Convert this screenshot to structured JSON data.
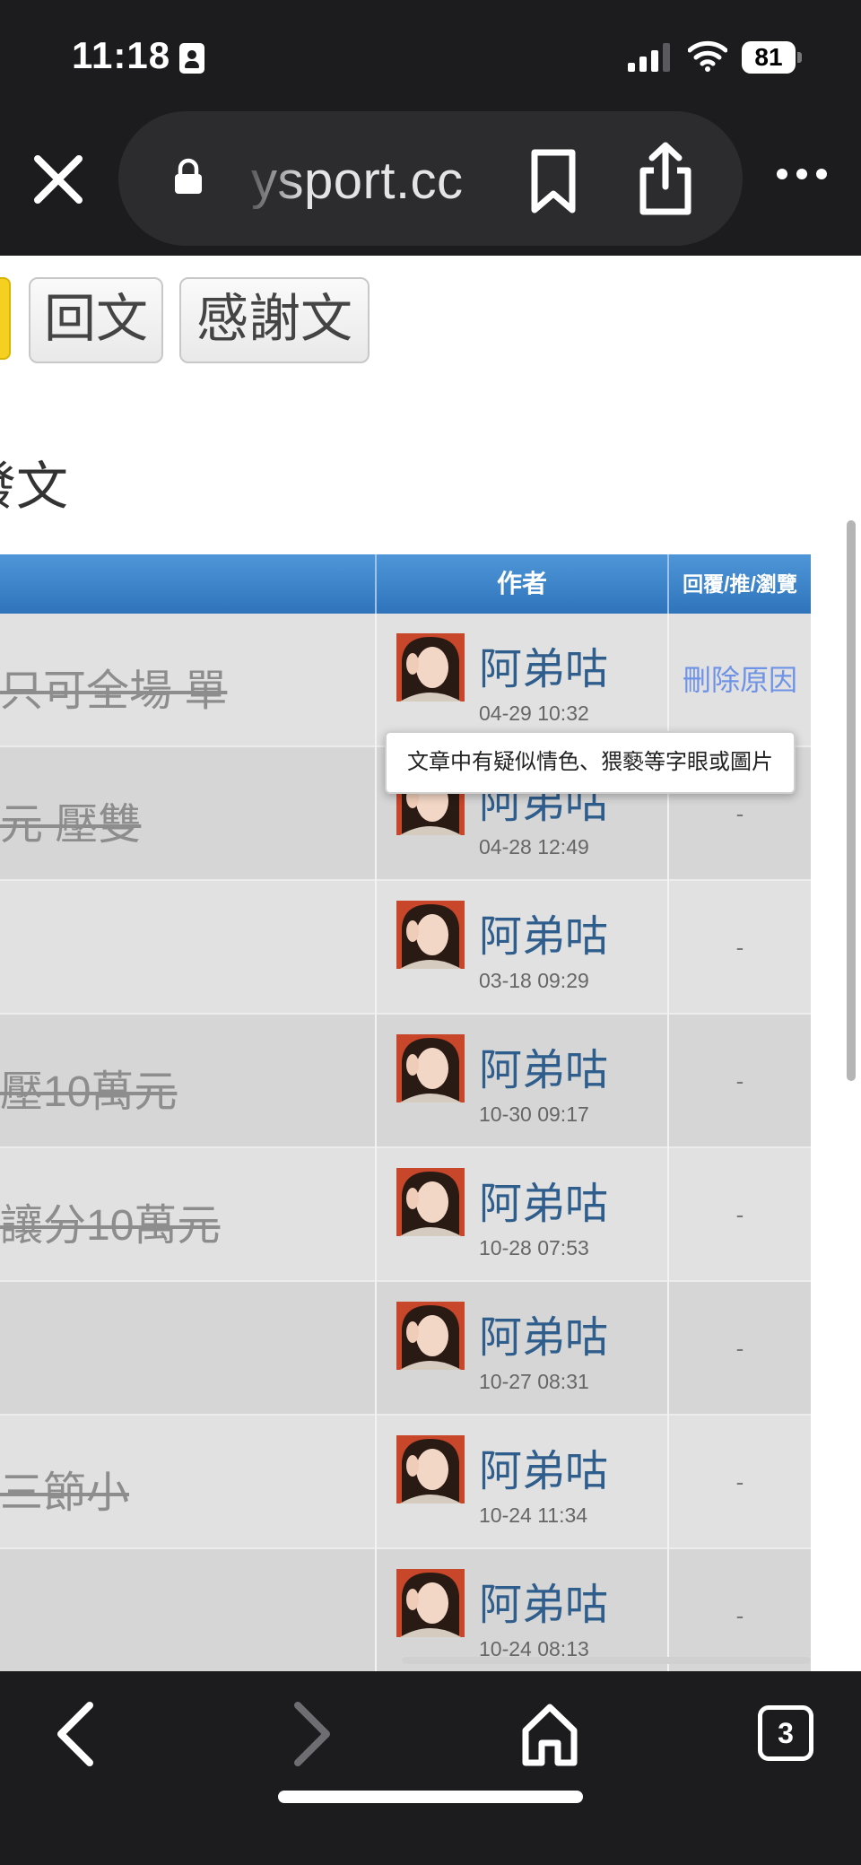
{
  "status_bar": {
    "time": "11:18",
    "battery": "81"
  },
  "browser": {
    "url": "ysport.cc",
    "tab_count": "3"
  },
  "page": {
    "buttons": {
      "reply": "回文",
      "thanks": "感謝文"
    },
    "section_heading": "發文"
  },
  "table": {
    "headers": {
      "author": "作者",
      "stats": "回覆/推/瀏覽"
    },
    "rows": [
      {
        "title": "只可全場 單",
        "author": "阿弟咕",
        "date": "04-29 10:32",
        "stats": "刪除原因"
      },
      {
        "title": "元 壓雙",
        "author": "阿弟咕",
        "date": "04-28 12:49",
        "stats": "-"
      },
      {
        "title": "",
        "author": "阿弟咕",
        "date": "03-18 09:29",
        "stats": "-"
      },
      {
        "title": "壓10萬元",
        "author": "阿弟咕",
        "date": "10-30 09:17",
        "stats": "-"
      },
      {
        "title": "讓分10萬元",
        "author": "阿弟咕",
        "date": "10-28 07:53",
        "stats": "-"
      },
      {
        "title": "",
        "author": "阿弟咕",
        "date": "10-27 08:31",
        "stats": "-"
      },
      {
        "title": "三節小",
        "author": "阿弟咕",
        "date": "10-24 11:34",
        "stats": "-"
      },
      {
        "title": "",
        "author": "阿弟咕",
        "date": "10-24 08:13",
        "stats": "-"
      }
    ]
  },
  "tooltip": "文章中有疑似情色、猥褻等字眼或圖片",
  "colors": {
    "header_blue": "#3a82c6",
    "link_blue": "#6e93e6",
    "author_blue": "#2f5d8c",
    "toolbar_dark": "#1c1c1e"
  }
}
